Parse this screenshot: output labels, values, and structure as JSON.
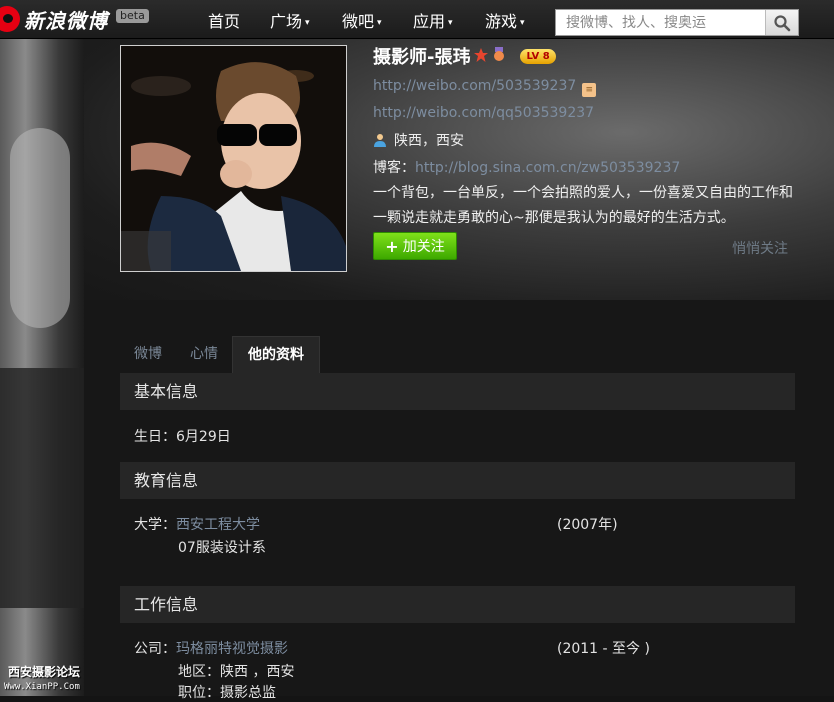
{
  "header": {
    "logo_text": "新浪微博",
    "beta_label": "beta",
    "nav": [
      {
        "label": "首页",
        "caret": ""
      },
      {
        "label": "广场",
        "caret": "▾"
      },
      {
        "label": "微吧",
        "caret": "▾"
      },
      {
        "label": "应用",
        "caret": "▾"
      },
      {
        "label": "游戏",
        "caret": "▾"
      }
    ],
    "search_placeholder": "搜微博、找人、搜奥运"
  },
  "profile": {
    "name": "摄影师-張玮",
    "level": "LV 8",
    "weibo_url": "http://weibo.com/503539237",
    "weibo_alias_url": "http://weibo.com/qq503539237",
    "location": "陕西，西安",
    "blog_label": "博客：",
    "blog_url": "http://blog.sina.com.cn/zw503539237",
    "bio": "一个背包，一台单反，一个会拍照的爱人，一份喜爱又自由的工作和一颗说走就走勇敢的心~那便是我认为的最好的生活方式。",
    "follow_label": "加关注",
    "quiet_follow_label": "悄悄关注"
  },
  "tabs": [
    {
      "label": "微博",
      "active": false
    },
    {
      "label": "心情",
      "active": false
    },
    {
      "label": "他的资料",
      "active": true
    }
  ],
  "basic": {
    "title": "基本信息",
    "birthday_label": "生日：",
    "birthday": "6月29日"
  },
  "education": {
    "title": "教育信息",
    "university_label": "大学：",
    "university": "西安工程大学",
    "department": "07服装设计系",
    "year": "(2007年)"
  },
  "work": {
    "title": "工作信息",
    "company_label": "公司：",
    "company": "玛格丽特视觉摄影",
    "period": "(2011 - 至今 )",
    "region_label": "地区：",
    "region": "陕西 ，西安",
    "position_label": "职位：",
    "position": "摄影总监"
  },
  "watermark": {
    "text": "西安摄影论坛",
    "url": "Www.XianPP.Com"
  },
  "colors": {
    "link": "#7d8da0",
    "follow_green": "#3da800",
    "brand_red": "#e60012"
  }
}
